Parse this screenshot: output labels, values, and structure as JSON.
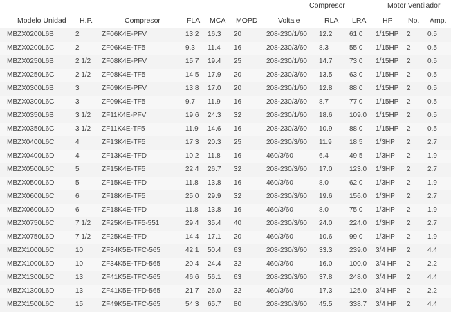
{
  "groups": {
    "compresor": "Compresor",
    "motor": "Motor Ventilador"
  },
  "headers": {
    "modelo": "Modelo Unidad",
    "hp": "H.P.",
    "compresor": "Compresor",
    "fla": "FLA",
    "mca": "MCA",
    "mopd": "MOPD",
    "voltaje": "Voltaje",
    "rla": "RLA",
    "lra": "LRA",
    "mhp": "HP",
    "no": "No.",
    "amp": "Amp."
  },
  "rows": [
    {
      "modelo": "MBZX0200L6B",
      "hp": "2",
      "compresor": "ZF06K4E-PFV",
      "fla": "13.2",
      "mca": "16.3",
      "mopd": "20",
      "voltaje": "208-230/1/60",
      "rla": "12.2",
      "lra": "61.0",
      "mhp": "1/15HP",
      "no": "2",
      "amp": "0.5"
    },
    {
      "modelo": "MBZX0200L6C",
      "hp": "2",
      "compresor": "ZF06K4E-TF5",
      "fla": "9.3",
      "mca": "11.4",
      "mopd": "16",
      "voltaje": "208-230/3/60",
      "rla": "8.3",
      "lra": "55.0",
      "mhp": "1/15HP",
      "no": "2",
      "amp": "0.5"
    },
    {
      "modelo": "MBZX0250L6B",
      "hp": "2 1/2",
      "compresor": "ZF08K4E-PFV",
      "fla": "15.7",
      "mca": "19.4",
      "mopd": "25",
      "voltaje": "208-230/1/60",
      "rla": "14.7",
      "lra": "73.0",
      "mhp": "1/15HP",
      "no": "2",
      "amp": "0.5"
    },
    {
      "modelo": "MBZX0250L6C",
      "hp": "2 1/2",
      "compresor": "ZF08K4E-TF5",
      "fla": "14.5",
      "mca": "17.9",
      "mopd": "20",
      "voltaje": "208-230/3/60",
      "rla": "13.5",
      "lra": "63.0",
      "mhp": "1/15HP",
      "no": "2",
      "amp": "0.5"
    },
    {
      "modelo": "MBZX0300L6B",
      "hp": "3",
      "compresor": "ZF09K4E-PFV",
      "fla": "13.8",
      "mca": "17.0",
      "mopd": "20",
      "voltaje": "208-230/1/60",
      "rla": "12.8",
      "lra": "88.0",
      "mhp": "1/15HP",
      "no": "2",
      "amp": "0.5"
    },
    {
      "modelo": "MBZX0300L6C",
      "hp": "3",
      "compresor": "ZF09K4E-TF5",
      "fla": "9.7",
      "mca": "11.9",
      "mopd": "16",
      "voltaje": "208-230/3/60",
      "rla": "8.7",
      "lra": "77.0",
      "mhp": "1/15HP",
      "no": "2",
      "amp": "0.5"
    },
    {
      "modelo": "MBZX0350L6B",
      "hp": "3 1/2",
      "compresor": "ZF11K4E-PFV",
      "fla": "19.6",
      "mca": "24.3",
      "mopd": "32",
      "voltaje": "208-230/1/60",
      "rla": "18.6",
      "lra": "109.0",
      "mhp": "1/15HP",
      "no": "2",
      "amp": "0.5"
    },
    {
      "modelo": "MBZX0350L6C",
      "hp": "3 1/2",
      "compresor": "ZF11K4E-TF5",
      "fla": "11.9",
      "mca": "14.6",
      "mopd": "16",
      "voltaje": "208-230/3/60",
      "rla": "10.9",
      "lra": "88.0",
      "mhp": "1/15HP",
      "no": "2",
      "amp": "0.5"
    },
    {
      "modelo": "MBZX0400L6C",
      "hp": "4",
      "compresor": "ZF13K4E-TF5",
      "fla": "17.3",
      "mca": "20.3",
      "mopd": "25",
      "voltaje": "208-230/3/60",
      "rla": "11.9",
      "lra": "18.5",
      "mhp": "1/3HP",
      "no": "2",
      "amp": "2.7"
    },
    {
      "modelo": "MBZX0400L6D",
      "hp": "4",
      "compresor": "ZF13K4E-TFD",
      "fla": "10.2",
      "mca": "11.8",
      "mopd": "16",
      "voltaje": "460/3/60",
      "rla": "6.4",
      "lra": "49.5",
      "mhp": "1/3HP",
      "no": "2",
      "amp": "1.9"
    },
    {
      "modelo": "MBZX0500L6C",
      "hp": "5",
      "compresor": "ZF15K4E-TF5",
      "fla": "22.4",
      "mca": "26.7",
      "mopd": "32",
      "voltaje": "208-230/3/60",
      "rla": "17.0",
      "lra": "123.0",
      "mhp": "1/3HP",
      "no": "2",
      "amp": "2.7"
    },
    {
      "modelo": "MBZX0500L6D",
      "hp": "5",
      "compresor": "ZF15K4E-TFD",
      "fla": "11.8",
      "mca": "13.8",
      "mopd": "16",
      "voltaje": "460/3/60",
      "rla": "8.0",
      "lra": "62.0",
      "mhp": "1/3HP",
      "no": "2",
      "amp": "1.9"
    },
    {
      "modelo": "MBZX0600L6C",
      "hp": "6",
      "compresor": "ZF18K4E-TF5",
      "fla": "25.0",
      "mca": "29.9",
      "mopd": "32",
      "voltaje": "208-230/3/60",
      "rla": "19.6",
      "lra": "156.0",
      "mhp": "1/3HP",
      "no": "2",
      "amp": "2.7"
    },
    {
      "modelo": "MBZX0600L6D",
      "hp": "6",
      "compresor": "ZF18K4E-TFD",
      "fla": "11.8",
      "mca": "13.8",
      "mopd": "16",
      "voltaje": "460/3/60",
      "rla": "8.0",
      "lra": "75.0",
      "mhp": "1/3HP",
      "no": "2",
      "amp": "1.9"
    },
    {
      "modelo": "MBZX0750L6C",
      "hp": "7 1/2",
      "compresor": "ZF25K4E-TF5-551",
      "fla": "29.4",
      "mca": "35.4",
      "mopd": "40",
      "voltaje": "208-230/3/60",
      "rla": "24.0",
      "lra": "224.0",
      "mhp": "1/3HP",
      "no": "2",
      "amp": "2.7"
    },
    {
      "modelo": "MBZX0750L6D",
      "hp": "7 1/2",
      "compresor": "ZF25K4E-TFD",
      "fla": "14.4",
      "mca": "17.1",
      "mopd": "20",
      "voltaje": "460/3/60",
      "rla": "10.6",
      "lra": "99.0",
      "mhp": "1/3HP",
      "no": "2",
      "amp": "1.9"
    },
    {
      "modelo": "MBZX1000L6C",
      "hp": "10",
      "compresor": "ZF34K5E-TFC-565",
      "fla": "42.1",
      "mca": "50.4",
      "mopd": "63",
      "voltaje": "208-230/3/60",
      "rla": "33.3",
      "lra": "239.0",
      "mhp": "3/4 HP",
      "no": "2",
      "amp": "4.4"
    },
    {
      "modelo": "MBZX1000L6D",
      "hp": "10",
      "compresor": "ZF34K5E-TFD-565",
      "fla": "20.4",
      "mca": "24.4",
      "mopd": "32",
      "voltaje": "460/3/60",
      "rla": "16.0",
      "lra": "100.0",
      "mhp": "3/4 HP",
      "no": "2",
      "amp": "2.2"
    },
    {
      "modelo": "MBZX1300L6C",
      "hp": "13",
      "compresor": "ZF41K5E-TFC-565",
      "fla": "46.6",
      "mca": "56.1",
      "mopd": "63",
      "voltaje": "208-230/3/60",
      "rla": "37.8",
      "lra": "248.0",
      "mhp": "3/4 HP",
      "no": "2",
      "amp": "4.4"
    },
    {
      "modelo": "MBZX1300L6D",
      "hp": "13",
      "compresor": "ZF41K5E-TFD-565",
      "fla": "21.7",
      "mca": "26.0",
      "mopd": "32",
      "voltaje": "460/3/60",
      "rla": "17.3",
      "lra": "125.0",
      "mhp": "3/4 HP",
      "no": "2",
      "amp": "2.2"
    },
    {
      "modelo": "MBZX1500L6C",
      "hp": "15",
      "compresor": "ZF49K5E-TFC-565",
      "fla": "54.3",
      "mca": "65.7",
      "mopd": "80",
      "voltaje": "208-230/3/60",
      "rla": "45.5",
      "lra": "338.7",
      "mhp": "3/4 HP",
      "no": "2",
      "amp": "4.4"
    }
  ]
}
